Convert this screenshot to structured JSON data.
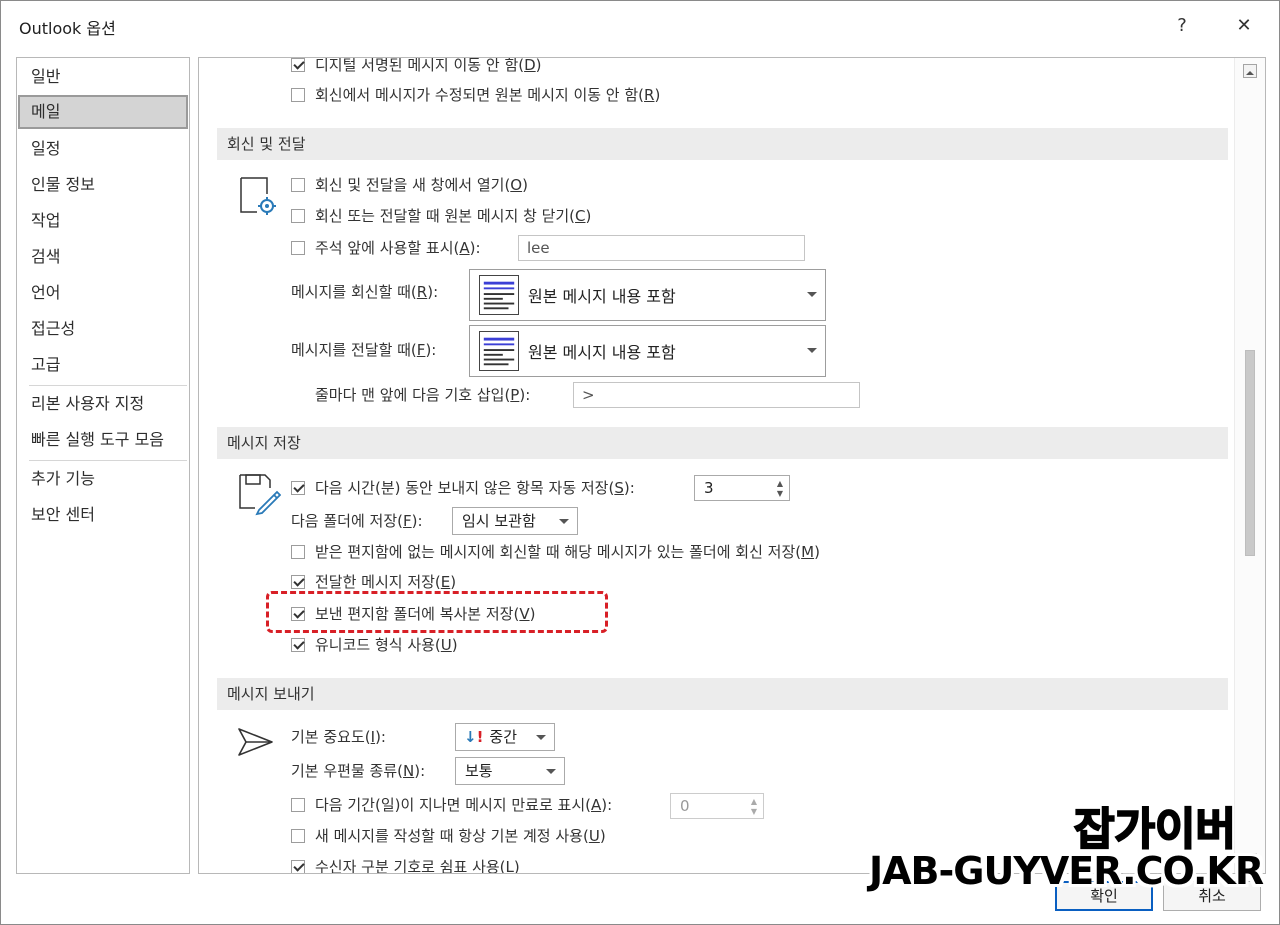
{
  "window": {
    "title": "Outlook 옵션",
    "help": "?",
    "close": "✕"
  },
  "nav": {
    "items": [
      {
        "label": "일반"
      },
      {
        "label": "메일"
      },
      {
        "label": "일정"
      },
      {
        "label": "인물 정보"
      },
      {
        "label": "작업"
      },
      {
        "label": "검색"
      },
      {
        "label": "언어"
      },
      {
        "label": "접근성"
      },
      {
        "label": "고급"
      },
      {
        "label": "리본 사용자 지정"
      },
      {
        "label": "빠른 실행 도구 모음"
      },
      {
        "label": "추가 기능"
      },
      {
        "label": "보안 센터"
      }
    ],
    "selected": "메일"
  },
  "top_options": {
    "digital_sig": {
      "text": "디지털 서명된 메시지 이동 안 함(",
      "key": "D",
      "end": ")",
      "checked": true
    },
    "modified_reply": {
      "text": "회신에서 메시지가 수정되면 원본 메시지 이동 안 함(",
      "key": "R",
      "end": ")",
      "checked": false
    }
  },
  "reply": {
    "header": "회신 및 전달",
    "open_new": {
      "text": "회신 및 전달을 새 창에서 열기(",
      "key": "O",
      "end": ")",
      "checked": false
    },
    "close_orig": {
      "text": "회신 또는 전달할 때 원본 메시지 창 닫기(",
      "key": "C",
      "end": ")",
      "checked": false
    },
    "preface": {
      "text": "주석 앞에 사용할 표시(",
      "key": "A",
      "end": "):",
      "checked": false,
      "value": "lee"
    },
    "when_reply": {
      "label": "메시지를 회신할 때(",
      "key": "R",
      "end": "):",
      "value": "원본 메시지 내용 포함"
    },
    "when_forward": {
      "label": "메시지를 전달할 때(",
      "key": "F",
      "end": "):",
      "value": "원본 메시지 내용 포함"
    },
    "prefix": {
      "label": "줄마다 맨 앞에 다음 기호 삽입(",
      "key": "P",
      "end": "):",
      "value": ">"
    }
  },
  "save": {
    "header": "메시지 저장",
    "autosave": {
      "text": "다음 시간(분) 동안 보내지 않은 항목 자동 저장(",
      "key": "S",
      "end": "):",
      "checked": true,
      "value": "3"
    },
    "folder": {
      "label": "다음 폴더에 저장(",
      "key": "F",
      "end": "):",
      "value": "임시 보관함"
    },
    "reply_in_folder": {
      "text": "받은 편지함에 없는 메시지에 회신할 때 해당 메시지가 있는 폴더에 회신 저장(",
      "key": "M",
      "end": ")",
      "checked": false
    },
    "save_forwarded": {
      "text": "전달한 메시지 저장(",
      "key": "E",
      "end": ")",
      "checked": true
    },
    "save_sent_copy": {
      "text": "보낸 편지함 폴더에 복사본 저장(",
      "key": "V",
      "end": ")",
      "checked": true
    },
    "unicode": {
      "text": "유니코드 형식 사용(",
      "key": "U",
      "end": ")",
      "checked": true
    }
  },
  "send": {
    "header": "메시지 보내기",
    "importance": {
      "label": "기본 중요도(",
      "key": "I",
      "end": "):",
      "value": "중간"
    },
    "sensitivity": {
      "label": "기본 우편물 종류(",
      "key": "N",
      "end": "):",
      "value": "보통"
    },
    "expire": {
      "text": "다음 기간(일)이 지나면 메시지 만료로 표시(",
      "key": "A",
      "end": "):",
      "checked": false,
      "value": "0"
    },
    "default_account": {
      "text": "새 메시지를 작성할 때 항상 기본 계정 사용(",
      "key": "U",
      "end": ")",
      "checked": false
    },
    "comma": {
      "text": "수신자 구분 기호로 쉼표 사용(",
      "key": "L",
      "end": ")",
      "checked": true
    }
  },
  "buttons": {
    "ok": "확인",
    "cancel": "취소"
  },
  "watermark": {
    "line1": "잡가이버",
    "line2": "JAB-GUYVER.CO.KR"
  },
  "colors": {
    "highlight": "#d81f26",
    "primary_border": "#0a5fc1",
    "section_bg": "#ececec"
  }
}
